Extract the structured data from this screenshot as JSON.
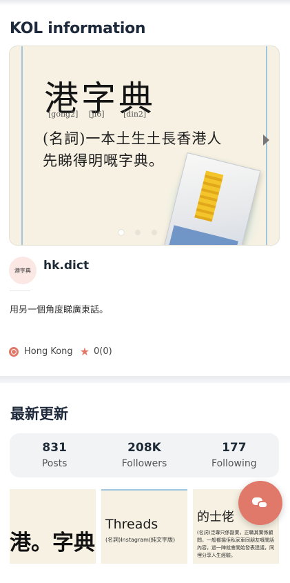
{
  "kol": {
    "section_title": "KOL information",
    "banner": {
      "title": "港字典",
      "pinyin": [
        "[gong2]",
        "[ji6]",
        "[din2]"
      ],
      "line1": "(名詞)一本土生土長香港人",
      "line2": "先睇得明嘅字典。"
    },
    "carousel_dots": 3,
    "carousel_active": 1,
    "avatar_text": "港字典",
    "name": "hk.dict",
    "bio": "用另一個角度睇廣東話。",
    "location": "Hong Kong",
    "rating": "0(0)"
  },
  "latest": {
    "section_title": "最新更新",
    "stats": [
      {
        "value": "831",
        "label": "Posts"
      },
      {
        "value": "208K",
        "label": "Followers"
      },
      {
        "value": "177",
        "label": "Following"
      }
    ],
    "thumbs": {
      "t1_text": "港。字典",
      "t2_title": "Threads",
      "t2_sub": "(名詞)Instagram(純文字版)",
      "t3_title": "的士佬",
      "t3_body": "(名詞)泛專只係副業，正職其實係顧問，一般都搵佢私家車同朋友嘅閒話內容，過一陣就會開始發表建議，同埋分享人生經驗。"
    }
  },
  "colors": {
    "accent": "#e0796a",
    "cream": "#f6f1e2",
    "stats_bg": "#f2f3f5"
  },
  "icons": {
    "location": "globe-icon",
    "rating": "star-icon",
    "fab": "chat-bubbles-icon"
  }
}
